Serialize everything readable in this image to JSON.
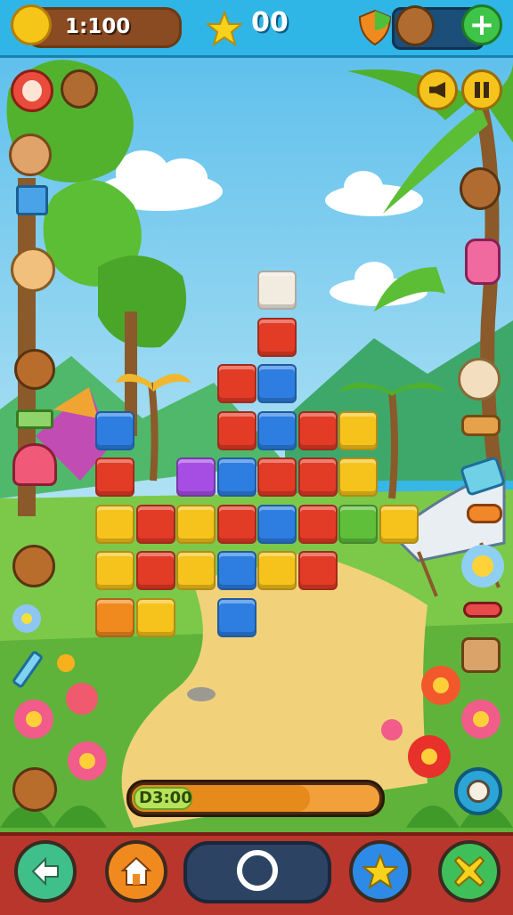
{
  "hud": {
    "coins": "1:100",
    "stars": "00",
    "progress_label": "D3:00",
    "progress_fraction": 0.72
  },
  "icons": {
    "coin": "coin-icon",
    "star": "star-icon",
    "shield": "shield-icon",
    "bear": "bear-avatar-icon",
    "plus": "plus-icon",
    "left_top": [
      "face-icon",
      "bear-icon"
    ],
    "right_top": [
      "sound-icon",
      "pause-icon"
    ],
    "bottom": [
      "back-arrow-icon",
      "home-icon",
      "circle-icon",
      "star-icon",
      "cross-icon"
    ]
  },
  "colors": {
    "blue": "#2d7ee0",
    "red": "#e23b26",
    "yellow": "#f6c31c",
    "orange": "#f08a1e",
    "purple": "#a64ee3",
    "white": "#f2ebe0",
    "green": "#5fbf3b",
    "sky": "#78c8ea"
  },
  "board": [
    {
      "col": 4,
      "row": 0,
      "c": "white"
    },
    {
      "col": 4,
      "row": 1,
      "c": "red"
    },
    {
      "col": 3,
      "row": 2,
      "c": "red"
    },
    {
      "col": 4,
      "row": 2,
      "c": "blue"
    },
    {
      "col": 0,
      "row": 3,
      "c": "blue"
    },
    {
      "col": 3,
      "row": 3,
      "c": "red"
    },
    {
      "col": 4,
      "row": 3,
      "c": "blue"
    },
    {
      "col": 5,
      "row": 3,
      "c": "red"
    },
    {
      "col": 6,
      "row": 3,
      "c": "yellow"
    },
    {
      "col": 0,
      "row": 4,
      "c": "red"
    },
    {
      "col": 2,
      "row": 4,
      "c": "purple"
    },
    {
      "col": 3,
      "row": 4,
      "c": "blue"
    },
    {
      "col": 4,
      "row": 4,
      "c": "red"
    },
    {
      "col": 5,
      "row": 4,
      "c": "red"
    },
    {
      "col": 6,
      "row": 4,
      "c": "yellow"
    },
    {
      "col": 0,
      "row": 5,
      "c": "yellow"
    },
    {
      "col": 1,
      "row": 5,
      "c": "red"
    },
    {
      "col": 2,
      "row": 5,
      "c": "yellow"
    },
    {
      "col": 3,
      "row": 5,
      "c": "red"
    },
    {
      "col": 4,
      "row": 5,
      "c": "blue"
    },
    {
      "col": 5,
      "row": 5,
      "c": "red"
    },
    {
      "col": 6,
      "row": 5,
      "c": "green"
    },
    {
      "col": 7,
      "row": 5,
      "c": "yellow"
    },
    {
      "col": 0,
      "row": 6,
      "c": "yellow"
    },
    {
      "col": 1,
      "row": 6,
      "c": "red"
    },
    {
      "col": 2,
      "row": 6,
      "c": "yellow"
    },
    {
      "col": 3,
      "row": 6,
      "c": "blue"
    },
    {
      "col": 4,
      "row": 6,
      "c": "yellow"
    },
    {
      "col": 5,
      "row": 6,
      "c": "red"
    },
    {
      "col": 0,
      "row": 7,
      "c": "orange"
    },
    {
      "col": 1,
      "row": 7,
      "c": "yellow"
    },
    {
      "col": 3,
      "row": 7,
      "c": "blue"
    }
  ]
}
